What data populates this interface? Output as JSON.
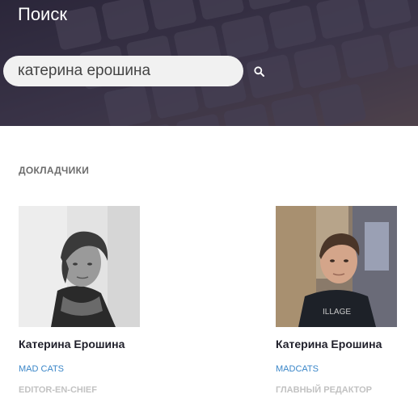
{
  "search": {
    "title": "Поиск",
    "query": "катерина ерошина"
  },
  "speakers_section": {
    "title": "ДОКЛАДЧИКИ",
    "speakers": [
      {
        "name": "Катерина Ерошина",
        "company": "MAD CATS",
        "role": "EDITOR-EN-CHIEF"
      },
      {
        "name": "Катерина Ерошина",
        "company": "MADCATS",
        "role": "ГЛАВНЫЙ РЕДАКТОР"
      }
    ]
  },
  "colors": {
    "accent_link": "#3a86c8",
    "name_text": "#1f1f2a",
    "muted_role": "#c2c2c2",
    "section_title": "#6c6c6c"
  },
  "icons": {
    "search_button": "search-icon"
  }
}
